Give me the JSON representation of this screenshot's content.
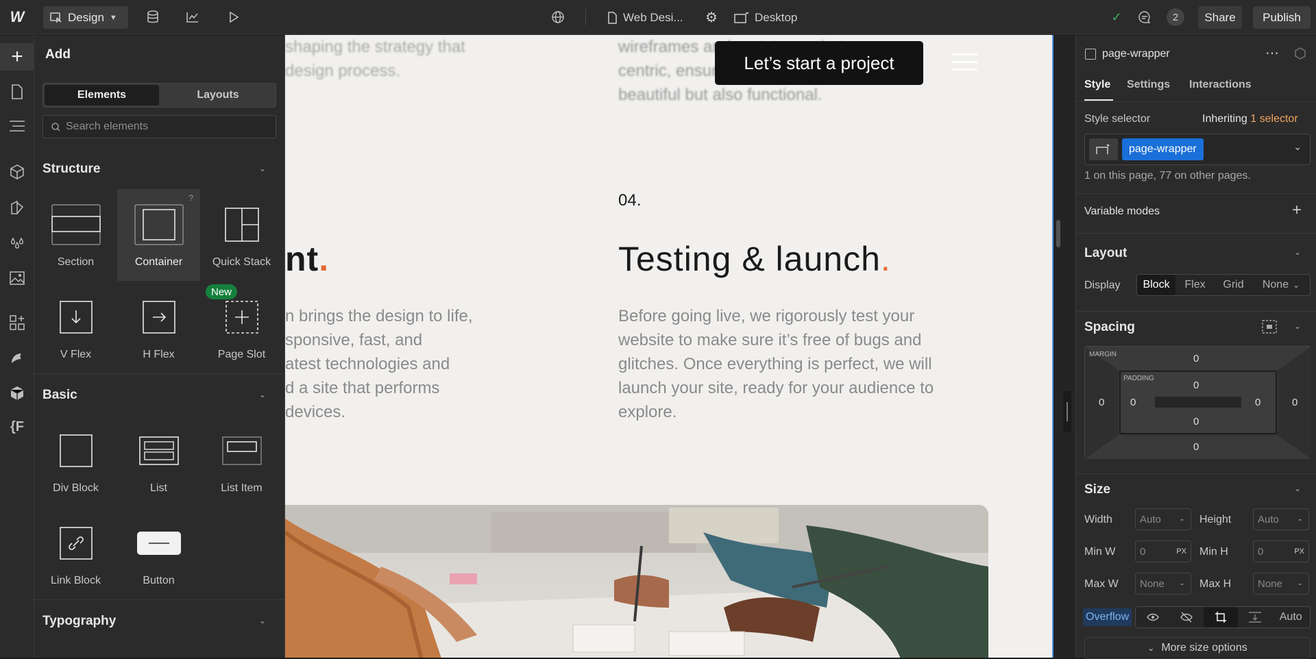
{
  "topbar": {
    "logo": "W",
    "mode_label": "Design",
    "page_name": "Web Desi...",
    "breakpoint": "Desktop",
    "comments_count": "2",
    "share_label": "Share",
    "publish_label": "Publish"
  },
  "add_panel": {
    "title": "Add",
    "tabs": [
      "Elements",
      "Layouts"
    ],
    "search_placeholder": "Search elements",
    "structure": {
      "title": "Structure",
      "items": [
        "Section",
        "Container",
        "Quick Stack",
        "V Flex",
        "H Flex",
        "Page Slot"
      ],
      "new_badge": "New",
      "help": "?"
    },
    "basic": {
      "title": "Basic",
      "items": [
        "Div Block",
        "List",
        "List Item",
        "Link Block",
        "Button"
      ]
    },
    "typography": {
      "title": "Typography"
    }
  },
  "canvas": {
    "cta": "Let’s start a project",
    "left_top_text": [
      "shaping the strategy that",
      "design process."
    ],
    "right_top_text": [
      "wireframes and prototypes that are user-",
      "centric, ensuring your website is not only",
      "beautiful but also functional."
    ],
    "step_number": "04.",
    "left_heading_fragment": "nt",
    "heading": "Testing & launch",
    "heading_dot": ".",
    "left_paragraph": [
      "n brings the design to life,",
      "sponsive, fast, and",
      "atest technologies and",
      "d a site that performs",
      "devices."
    ],
    "right_paragraph": [
      "Before going live, we rigorously test your",
      "website to make sure it’s free of bugs and",
      "glitches. Once everything is perfect, we will",
      "launch your site, ready for your audience to",
      "explore."
    ],
    "accent_color": "#e8692f"
  },
  "right_panel": {
    "element_name": "page-wrapper",
    "tabs": [
      "Style",
      "Settings",
      "Interactions"
    ],
    "style_selector_label": "Style selector",
    "inheriting_label": "Inheriting",
    "inheriting_count": "1 selector",
    "selector_chip": "page-wrapper",
    "usage_note": "1 on this page, 77 on other pages.",
    "variable_modes": "Variable modes",
    "layout": {
      "title": "Layout",
      "display_label": "Display",
      "display_options": [
        "Block",
        "Flex",
        "Grid",
        "None"
      ]
    },
    "spacing": {
      "title": "Spacing",
      "margin_label": "MARGIN",
      "padding_label": "PADDING",
      "margin": {
        "top": "0",
        "right": "0",
        "bottom": "0",
        "left": "0"
      },
      "padding": {
        "top": "0",
        "right": "0",
        "bottom": "0",
        "left": "0"
      }
    },
    "size": {
      "title": "Size",
      "width_label": "Width",
      "width_value": "Auto",
      "height_label": "Height",
      "height_value": "Auto",
      "min_w_label": "Min W",
      "min_w_value": "0",
      "min_h_label": "Min H",
      "min_h_value": "0",
      "max_w_label": "Max W",
      "max_w_value": "None",
      "max_h_label": "Max H",
      "max_h_value": "None",
      "unit": "PX",
      "dash": "-",
      "overflow_label": "Overflow",
      "overflow_auto": "Auto",
      "more_options": "More size options"
    }
  }
}
